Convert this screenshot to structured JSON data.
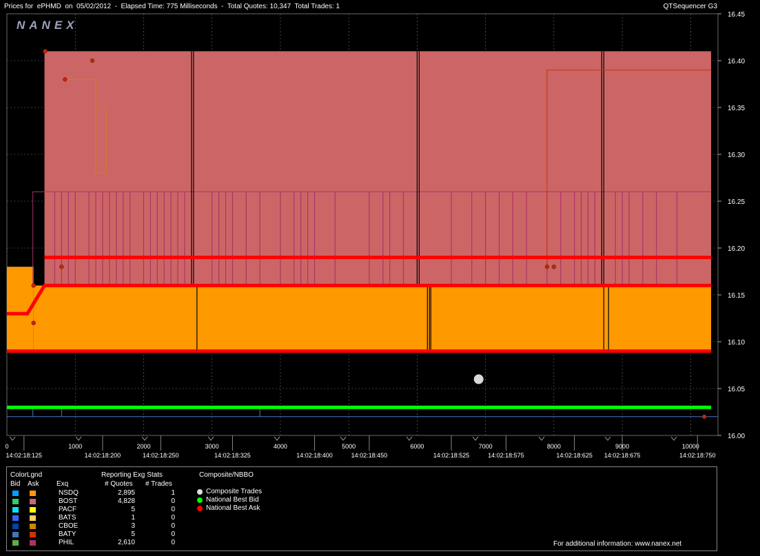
{
  "title": {
    "left": "Prices for  ePHMD  on  05/02/2012  -  Elapsed Time: 775 Milliseconds  -  Total Quotes: 10,347  Total Trades: 1",
    "right": "QTSequencer G3"
  },
  "logo": "NANEX",
  "chart_data": {
    "type": "line",
    "y_axis": {
      "min": 16.0,
      "max": 16.45,
      "ticks": [
        "16.45",
        "16.40",
        "16.35",
        "16.30",
        "16.25",
        "16.20",
        "16.15",
        "16.10",
        "16.05",
        "16.00"
      ]
    },
    "x_axis_seq": {
      "min": 0,
      "max": 10400,
      "ticks": [
        "0",
        "1000",
        "2000",
        "3000",
        "4000",
        "5000",
        "6000",
        "7000",
        "8000",
        "9000",
        "10000"
      ]
    },
    "x_axis_time": {
      "ticks": [
        {
          "seq": 250,
          "label": "14:02:18:125"
        },
        {
          "seq": 1400,
          "label": "14:02:18:200"
        },
        {
          "seq": 2250,
          "label": "14:02:18:250"
        },
        {
          "seq": 3300,
          "label": "14:02:18:325"
        },
        {
          "seq": 4500,
          "label": "14:02:18:400"
        },
        {
          "seq": 5300,
          "label": "14:02:18:450"
        },
        {
          "seq": 6500,
          "label": "14:02:18:525"
        },
        {
          "seq": 7300,
          "label": "14:02:18:575"
        },
        {
          "seq": 8300,
          "label": "14:02:18:625"
        },
        {
          "seq": 9000,
          "label": "14:02:18:675"
        },
        {
          "seq": 10100,
          "label": "14:02:18:750"
        }
      ]
    },
    "grid": true,
    "series": [
      {
        "name": "National Best Bid",
        "color": "#00ff00",
        "points": [
          [
            0,
            16.03
          ],
          [
            10300,
            16.03
          ]
        ]
      },
      {
        "name": "National Best Ask",
        "color": "#ff0000",
        "points": [
          [
            0,
            16.13
          ],
          [
            300,
            16.13
          ],
          [
            550,
            16.16
          ],
          [
            10300,
            16.16
          ]
        ]
      },
      {
        "color": "#ff0000",
        "points": [
          [
            550,
            16.19
          ],
          [
            10300,
            16.19
          ]
        ]
      },
      {
        "color": "#ff0000",
        "points": [
          [
            0,
            16.09
          ],
          [
            10300,
            16.09
          ]
        ]
      }
    ],
    "areas": [
      {
        "name": "BOST",
        "color": "#cc6666",
        "from": 16.16,
        "to": 16.41,
        "x0": 550,
        "x1": 10300
      },
      {
        "name": "NSDQ",
        "color": "#ff9900",
        "from": 16.09,
        "to": 16.18,
        "x0": 0,
        "x1": 390
      },
      {
        "name": "NSDQ",
        "color": "#ff9900",
        "from": 16.09,
        "to": 16.16,
        "x0": 390,
        "x1": 10300
      }
    ],
    "trades": [
      {
        "name": "Composite Trades",
        "x": 6900,
        "y": 16.06
      }
    ]
  },
  "legend": {
    "color_lgnd": "ColorLgnd",
    "bid": "Bid",
    "ask": "Ask",
    "exq": "Exq",
    "reporting": "Reporting Exg Stats",
    "quotes_hdr": "# Quotes",
    "trades_hdr": "# Trades",
    "composite_hdr": "Composite/NBBO",
    "rows": [
      {
        "exq": "NSDQ",
        "quotes": "2,895",
        "trades": "1",
        "bid_color": "#00a0ff",
        "ask_color": "#ff9900"
      },
      {
        "exq": "BOST",
        "quotes": "4,828",
        "trades": "0",
        "bid_color": "#33cc66",
        "ask_color": "#cc6677"
      },
      {
        "exq": "PACF",
        "quotes": "5",
        "trades": "0",
        "bid_color": "#00e5ff",
        "ask_color": "#ffff00"
      },
      {
        "exq": "BATS",
        "quotes": "1",
        "trades": "0",
        "bid_color": "#3366ff",
        "ask_color": "#ffcc66"
      },
      {
        "exq": "CBOE",
        "quotes": "3",
        "trades": "0",
        "bid_color": "#0044aa",
        "ask_color": "#cc8800"
      },
      {
        "exq": "BATY",
        "quotes": "5",
        "trades": "0",
        "bid_color": "#4477aa",
        "ask_color": "#cc3300"
      },
      {
        "exq": "PHIL",
        "quotes": "2,610",
        "trades": "0",
        "bid_color": "#66aa44",
        "ask_color": "#aa3366"
      }
    ],
    "composite": [
      {
        "label": "Composite Trades",
        "color": "#dddddd"
      },
      {
        "label": "National Best Bid",
        "color": "#00ff00"
      },
      {
        "label": "National Best Ask",
        "color": "#ff0000"
      }
    ],
    "footer": "For additional information: www.nanex.net"
  }
}
